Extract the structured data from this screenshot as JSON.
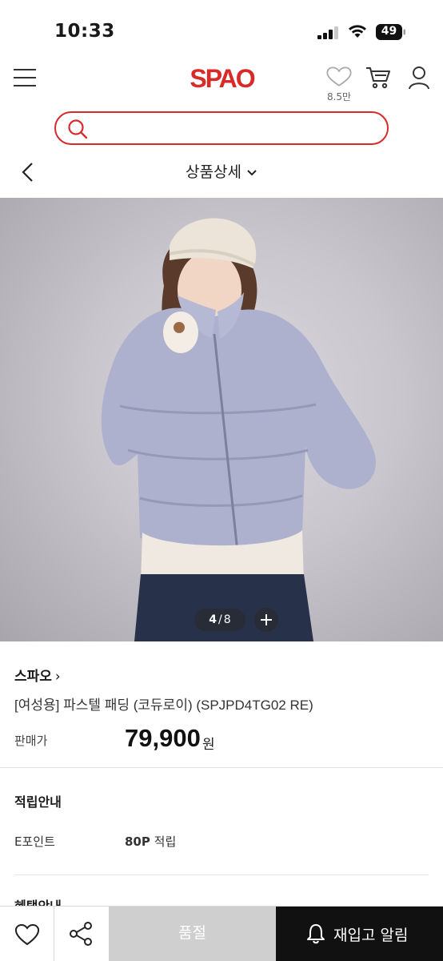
{
  "status_bar": {
    "time": "10:33",
    "battery": "49"
  },
  "header": {
    "logo": "SPAO",
    "wish_count": "8.5만",
    "icons": [
      "menu-icon",
      "heart-icon",
      "cart-icon",
      "user-icon"
    ]
  },
  "search": {
    "placeholder": ""
  },
  "subnav": {
    "title": "상품상세"
  },
  "gallery": {
    "current": "4",
    "separator": "/",
    "total": "8"
  },
  "product": {
    "brand": "스파오",
    "brand_arrow": "›",
    "name": "[여성용] 파스텔 패딩 (코듀로이) (SPJPD4TG02 RE)",
    "price_label": "판매가",
    "price": "79,900",
    "price_unit": "원"
  },
  "points": {
    "title": "적립안내",
    "epoint_label": "E포인트",
    "epoint_amount": "80P",
    "epoint_suffix": "적립"
  },
  "benefit": {
    "title": "혜택안내"
  },
  "bottom_bar": {
    "soldout_label": "품절",
    "restock_label": "재입고 알림"
  },
  "colors": {
    "brand_red": "#d92a2a",
    "soldout_gray": "#cfcfcf",
    "restock_black": "#111111"
  }
}
